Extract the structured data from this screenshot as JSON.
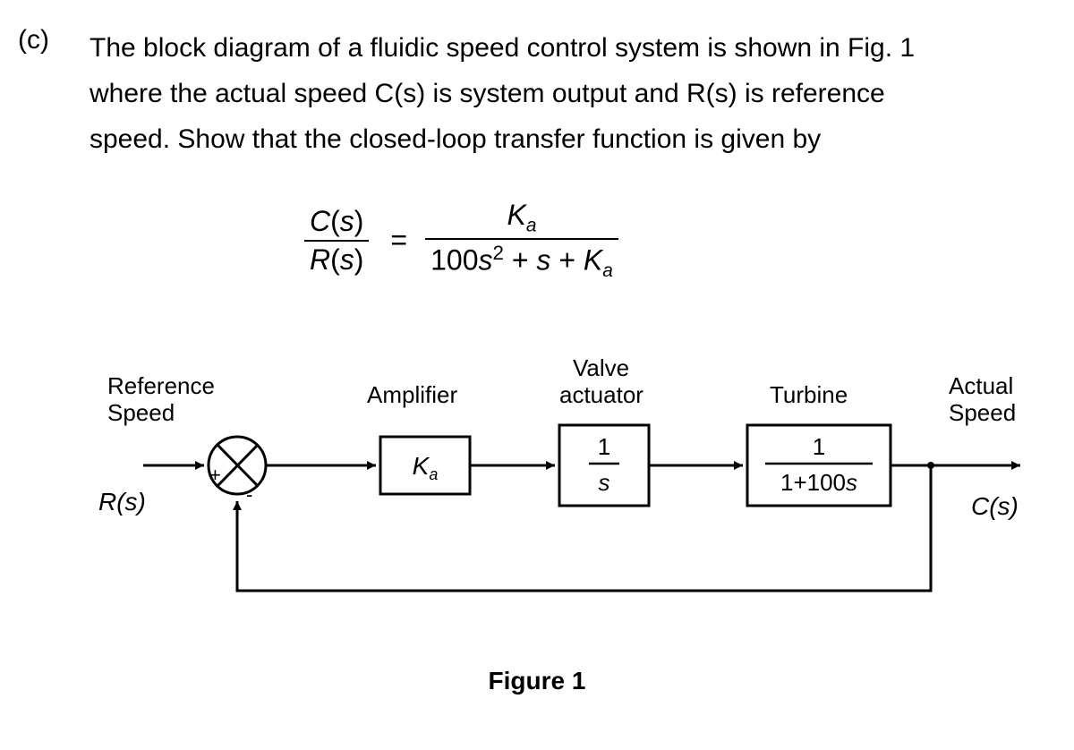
{
  "problem": {
    "part_label": "(c)",
    "line1": "The block diagram of a fluidic speed control system is shown in Fig. 1",
    "line2": "where the actual speed C(s) is system output and R(s) is reference",
    "line3": "speed. Show that the closed-loop transfer function is given by"
  },
  "equation": {
    "lhs_num": "C(s)",
    "lhs_den": "R(s)",
    "equals": "=",
    "rhs_num": "Kₐ",
    "rhs_den": "100s² + s + Kₐ"
  },
  "diagram": {
    "input_label_top": "Reference",
    "input_label_bot": "Speed",
    "input_signal": "R(s)",
    "summing_plus": "+",
    "summing_minus": "-",
    "amplifier_label": "Amplifier",
    "amplifier_tf": "Kₐ",
    "valve_label_top": "Valve",
    "valve_label_bot": "actuator",
    "valve_tf_num": "1",
    "valve_tf_den": "s",
    "turbine_label": "Turbine",
    "turbine_tf_num": "1",
    "turbine_tf_den": "1+100s",
    "output_label_top": "Actual",
    "output_label_bot": "Speed",
    "output_signal": "C(s)",
    "figure_caption": "Figure 1"
  },
  "chart_data": {
    "type": "block-diagram",
    "input": "R(s)",
    "output": "C(s)",
    "forward_path": [
      {
        "name": "Summing junction",
        "inputs": [
          "R(s) (+)",
          "feedback (-)"
        ]
      },
      {
        "name": "Amplifier",
        "tf": "K_a"
      },
      {
        "name": "Valve actuator",
        "tf": "1/s"
      },
      {
        "name": "Turbine",
        "tf": "1/(1+100s)"
      }
    ],
    "feedback": "unity negative feedback from C(s) to summing junction",
    "closed_loop_tf": "C(s)/R(s) = K_a / (100 s^2 + s + K_a)"
  }
}
